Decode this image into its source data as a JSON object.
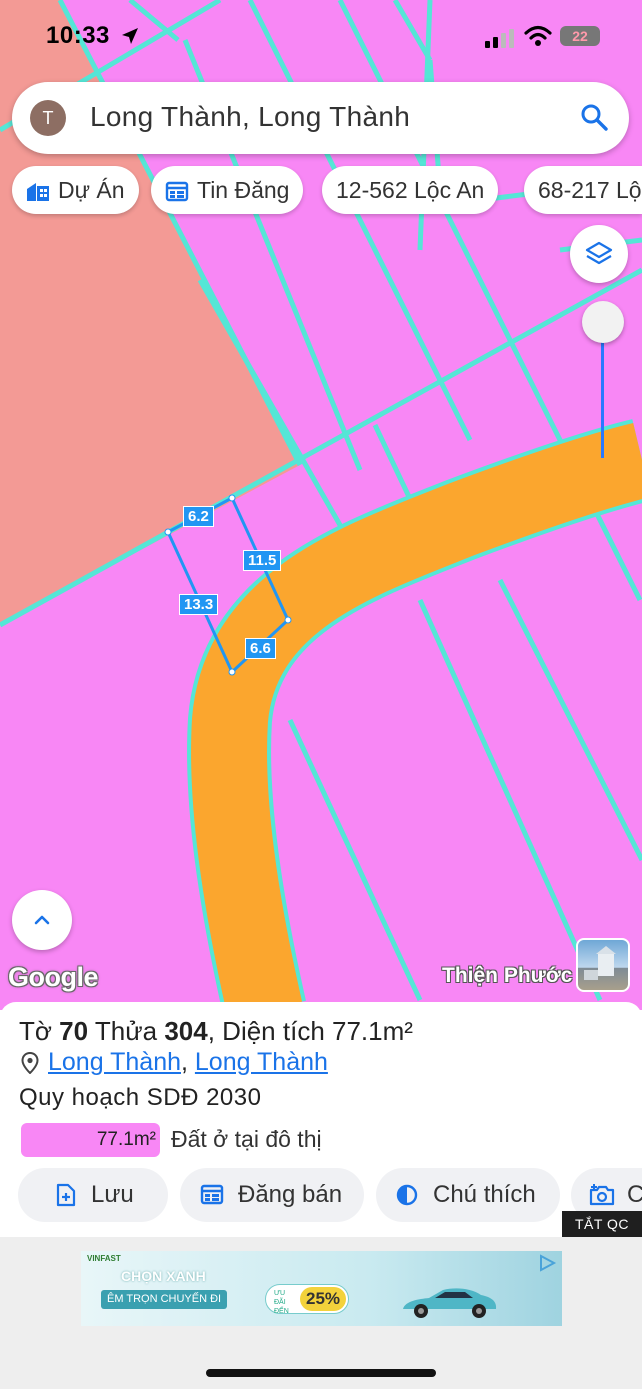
{
  "status_bar": {
    "time": "10:33",
    "battery": "22"
  },
  "search": {
    "avatar_letter": "T",
    "query": "Long Thành, Long Thành"
  },
  "chips": [
    {
      "label": "Dự Án",
      "icon": "building-icon"
    },
    {
      "label": "Tin Đăng",
      "icon": "listing-icon"
    },
    {
      "label": "12-562 Lộc An"
    },
    {
      "label": "68-217 Lộc"
    }
  ],
  "map": {
    "dimensions": {
      "top": "6.2",
      "right": "11.5",
      "left": "13.3",
      "bottom": "6.6"
    },
    "attribution": "Google",
    "place_label": "Thiện Phước",
    "colors": {
      "residential": "#f887f5",
      "road": "#fba62e",
      "other_land": "#f39a95",
      "parcel_border": "#55e6d6",
      "highlight": "#2196f3"
    }
  },
  "parcel": {
    "sheet_label": "Tờ",
    "sheet_no": "70",
    "lot_label": "Thửa",
    "lot_no": "304",
    "area_label": "Diện tích",
    "area": "77.1m²",
    "location_1": "Long Thành",
    "location_sep": ",",
    "location_2": "Long Thành",
    "plan": "Quy hoạch SDĐ 2030",
    "legend_area": "77.1m²",
    "legend_desc": "Đất ở tại đô thị"
  },
  "actions": [
    {
      "label": "Lưu",
      "icon": "save-file-icon"
    },
    {
      "label": "Đăng bán",
      "icon": "post-sale-icon"
    },
    {
      "label": "Chú thích",
      "icon": "legend-icon"
    },
    {
      "label": "C",
      "icon": "camera-icon"
    }
  ],
  "ad": {
    "close_label": "TẮT QC",
    "brand": "VINFAST",
    "headline": "CHỌN XANH",
    "subline": "ÊM TRỌN CHUYẾN ĐI",
    "deal_small": "ƯU ĐÃI ĐẾN",
    "deal_big": "25%"
  }
}
